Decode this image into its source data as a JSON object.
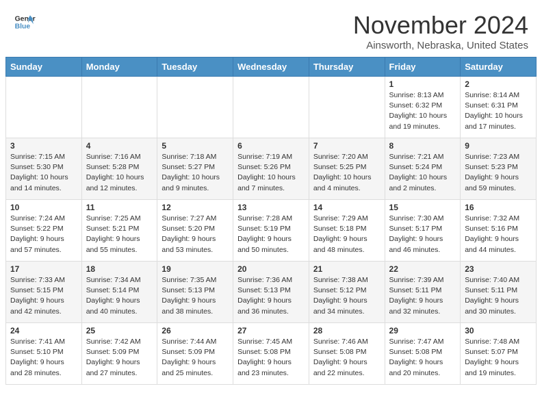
{
  "header": {
    "logo_line1": "General",
    "logo_line2": "Blue",
    "month": "November 2024",
    "location": "Ainsworth, Nebraska, United States"
  },
  "days_of_week": [
    "Sunday",
    "Monday",
    "Tuesday",
    "Wednesday",
    "Thursday",
    "Friday",
    "Saturday"
  ],
  "weeks": [
    [
      {
        "day": "",
        "info": ""
      },
      {
        "day": "",
        "info": ""
      },
      {
        "day": "",
        "info": ""
      },
      {
        "day": "",
        "info": ""
      },
      {
        "day": "",
        "info": ""
      },
      {
        "day": "1",
        "info": "Sunrise: 8:13 AM\nSunset: 6:32 PM\nDaylight: 10 hours and 19 minutes."
      },
      {
        "day": "2",
        "info": "Sunrise: 8:14 AM\nSunset: 6:31 PM\nDaylight: 10 hours and 17 minutes."
      }
    ],
    [
      {
        "day": "3",
        "info": "Sunrise: 7:15 AM\nSunset: 5:30 PM\nDaylight: 10 hours and 14 minutes."
      },
      {
        "day": "4",
        "info": "Sunrise: 7:16 AM\nSunset: 5:28 PM\nDaylight: 10 hours and 12 minutes."
      },
      {
        "day": "5",
        "info": "Sunrise: 7:18 AM\nSunset: 5:27 PM\nDaylight: 10 hours and 9 minutes."
      },
      {
        "day": "6",
        "info": "Sunrise: 7:19 AM\nSunset: 5:26 PM\nDaylight: 10 hours and 7 minutes."
      },
      {
        "day": "7",
        "info": "Sunrise: 7:20 AM\nSunset: 5:25 PM\nDaylight: 10 hours and 4 minutes."
      },
      {
        "day": "8",
        "info": "Sunrise: 7:21 AM\nSunset: 5:24 PM\nDaylight: 10 hours and 2 minutes."
      },
      {
        "day": "9",
        "info": "Sunrise: 7:23 AM\nSunset: 5:23 PM\nDaylight: 9 hours and 59 minutes."
      }
    ],
    [
      {
        "day": "10",
        "info": "Sunrise: 7:24 AM\nSunset: 5:22 PM\nDaylight: 9 hours and 57 minutes."
      },
      {
        "day": "11",
        "info": "Sunrise: 7:25 AM\nSunset: 5:21 PM\nDaylight: 9 hours and 55 minutes."
      },
      {
        "day": "12",
        "info": "Sunrise: 7:27 AM\nSunset: 5:20 PM\nDaylight: 9 hours and 53 minutes."
      },
      {
        "day": "13",
        "info": "Sunrise: 7:28 AM\nSunset: 5:19 PM\nDaylight: 9 hours and 50 minutes."
      },
      {
        "day": "14",
        "info": "Sunrise: 7:29 AM\nSunset: 5:18 PM\nDaylight: 9 hours and 48 minutes."
      },
      {
        "day": "15",
        "info": "Sunrise: 7:30 AM\nSunset: 5:17 PM\nDaylight: 9 hours and 46 minutes."
      },
      {
        "day": "16",
        "info": "Sunrise: 7:32 AM\nSunset: 5:16 PM\nDaylight: 9 hours and 44 minutes."
      }
    ],
    [
      {
        "day": "17",
        "info": "Sunrise: 7:33 AM\nSunset: 5:15 PM\nDaylight: 9 hours and 42 minutes."
      },
      {
        "day": "18",
        "info": "Sunrise: 7:34 AM\nSunset: 5:14 PM\nDaylight: 9 hours and 40 minutes."
      },
      {
        "day": "19",
        "info": "Sunrise: 7:35 AM\nSunset: 5:13 PM\nDaylight: 9 hours and 38 minutes."
      },
      {
        "day": "20",
        "info": "Sunrise: 7:36 AM\nSunset: 5:13 PM\nDaylight: 9 hours and 36 minutes."
      },
      {
        "day": "21",
        "info": "Sunrise: 7:38 AM\nSunset: 5:12 PM\nDaylight: 9 hours and 34 minutes."
      },
      {
        "day": "22",
        "info": "Sunrise: 7:39 AM\nSunset: 5:11 PM\nDaylight: 9 hours and 32 minutes."
      },
      {
        "day": "23",
        "info": "Sunrise: 7:40 AM\nSunset: 5:11 PM\nDaylight: 9 hours and 30 minutes."
      }
    ],
    [
      {
        "day": "24",
        "info": "Sunrise: 7:41 AM\nSunset: 5:10 PM\nDaylight: 9 hours and 28 minutes."
      },
      {
        "day": "25",
        "info": "Sunrise: 7:42 AM\nSunset: 5:09 PM\nDaylight: 9 hours and 27 minutes."
      },
      {
        "day": "26",
        "info": "Sunrise: 7:44 AM\nSunset: 5:09 PM\nDaylight: 9 hours and 25 minutes."
      },
      {
        "day": "27",
        "info": "Sunrise: 7:45 AM\nSunset: 5:08 PM\nDaylight: 9 hours and 23 minutes."
      },
      {
        "day": "28",
        "info": "Sunrise: 7:46 AM\nSunset: 5:08 PM\nDaylight: 9 hours and 22 minutes."
      },
      {
        "day": "29",
        "info": "Sunrise: 7:47 AM\nSunset: 5:08 PM\nDaylight: 9 hours and 20 minutes."
      },
      {
        "day": "30",
        "info": "Sunrise: 7:48 AM\nSunset: 5:07 PM\nDaylight: 9 hours and 19 minutes."
      }
    ]
  ]
}
